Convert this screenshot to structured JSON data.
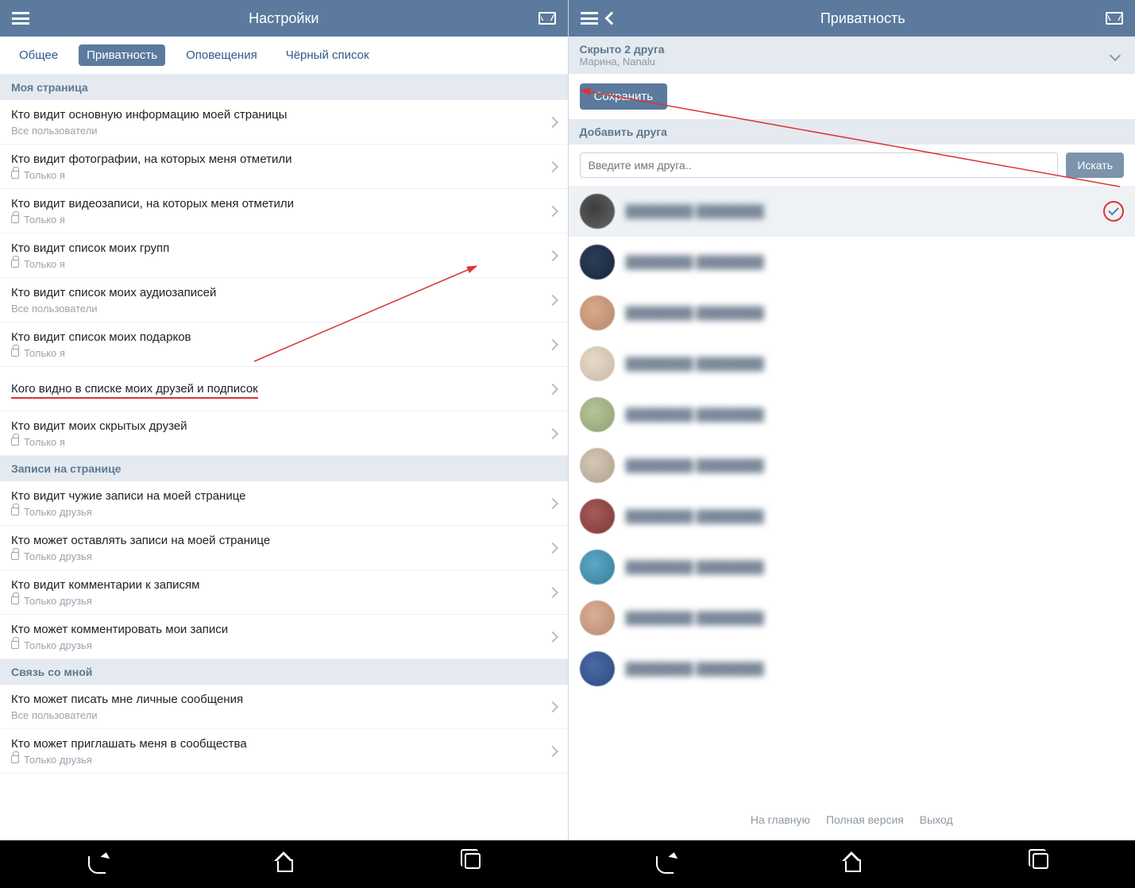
{
  "left": {
    "header_title": "Настройки",
    "tabs": [
      "Общее",
      "Приватность",
      "Оповещения",
      "Чёрный список"
    ],
    "active_tab": 1,
    "sections": [
      {
        "title": "Моя страница",
        "items": [
          {
            "title": "Кто видит основную информацию моей страницы",
            "sub": "Все пользователи",
            "lock": false
          },
          {
            "title": "Кто видит фотографии, на которых меня отметили",
            "sub": "Только я",
            "lock": true
          },
          {
            "title": "Кто видит видеозаписи, на которых меня отметили",
            "sub": "Только я",
            "lock": true
          },
          {
            "title": "Кто видит список моих групп",
            "sub": "Только я",
            "lock": true
          },
          {
            "title": "Кто видит список моих аудиозаписей",
            "sub": "Все пользователи",
            "lock": false
          },
          {
            "title": "Кто видит список моих подарков",
            "sub": "Только я",
            "lock": true
          },
          {
            "title": "Кого видно в списке моих друзей и подписок",
            "sub": "",
            "lock": false,
            "highlight": true
          },
          {
            "title": "Кто видит моих скрытых друзей",
            "sub": "Только я",
            "lock": true
          }
        ]
      },
      {
        "title": "Записи на странице",
        "items": [
          {
            "title": "Кто видит чужие записи на моей странице",
            "sub": "Только друзья",
            "lock": true
          },
          {
            "title": "Кто может оставлять записи на моей странице",
            "sub": "Только друзья",
            "lock": true
          },
          {
            "title": "Кто видит комментарии к записям",
            "sub": "Только друзья",
            "lock": true
          },
          {
            "title": "Кто может комментировать мои записи",
            "sub": "Только друзья",
            "lock": true
          }
        ]
      },
      {
        "title": "Связь со мной",
        "items": [
          {
            "title": "Кто может писать мне личные сообщения",
            "sub": "Все пользователи",
            "lock": false
          },
          {
            "title": "Кто может приглашать меня в сообщества",
            "sub": "Только друзья",
            "lock": true
          }
        ]
      }
    ]
  },
  "right": {
    "header_title": "Приватность",
    "hidden_title": "Скрыто 2 друга",
    "hidden_sub": "Марина, Nanalu",
    "save_label": "Сохранить",
    "add_friend_title": "Добавить друга",
    "search_placeholder": "Введите имя друга..",
    "search_button": "Искать",
    "friends": [
      {
        "selected": true
      },
      {
        "selected": false
      },
      {
        "selected": false
      },
      {
        "selected": false
      },
      {
        "selected": false
      },
      {
        "selected": false
      },
      {
        "selected": false
      },
      {
        "selected": false
      },
      {
        "selected": false
      },
      {
        "selected": false
      }
    ],
    "footer": [
      "На главную",
      "Полная версия",
      "Выход"
    ]
  }
}
